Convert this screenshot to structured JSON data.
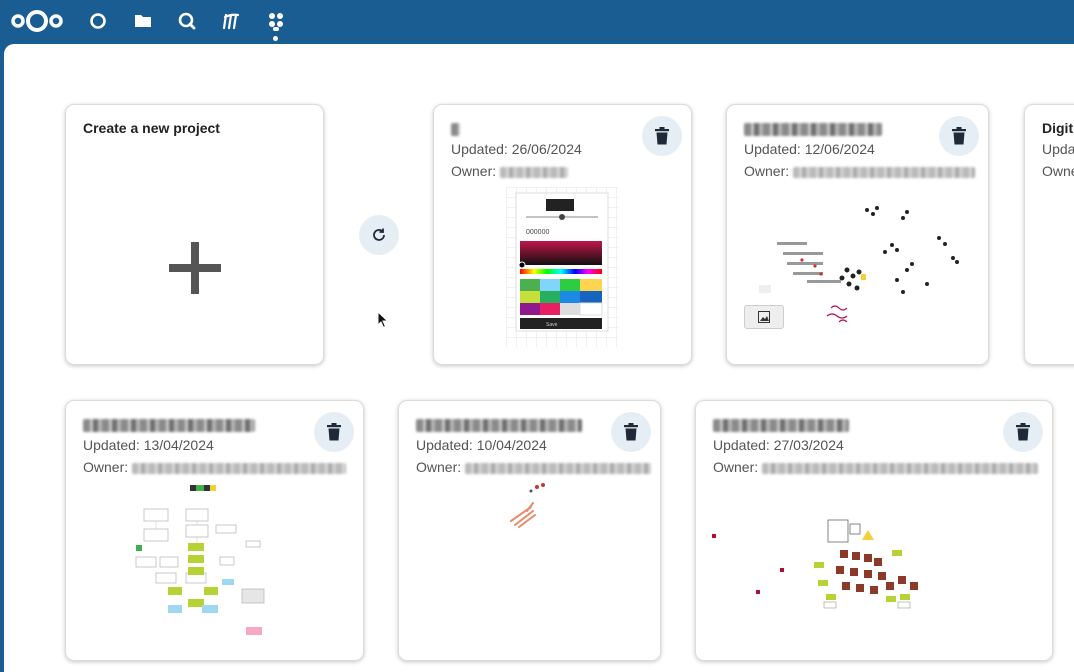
{
  "nav": {
    "logo": "nextcloud-logo",
    "icons": [
      "dashboard-icon",
      "files-icon",
      "search-icon",
      "activity-icon",
      "whiteboard-icon"
    ]
  },
  "create_card": {
    "title": "Create a new project"
  },
  "projects": [
    {
      "updated": "Updated: 26/06/2024",
      "owner_label": "Owner:",
      "preview_color_text": "000000",
      "preview_button": "Save"
    },
    {
      "updated": "Updated: 12/06/2024",
      "owner_label": "Owner:"
    },
    {
      "title": "Digit",
      "updated": "Upda",
      "owner_label": "Owne"
    },
    {
      "updated": "Updated: 13/04/2024",
      "owner_label": "Owner:"
    },
    {
      "updated": "Updated: 10/04/2024",
      "owner_label": "Owner:"
    },
    {
      "updated": "Updated: 27/03/2024",
      "owner_label": "Owner:"
    }
  ],
  "colors": {
    "header": "#1a5d93",
    "button_bg": "#e6eef5",
    "icon_dark": "#1e2a38"
  }
}
